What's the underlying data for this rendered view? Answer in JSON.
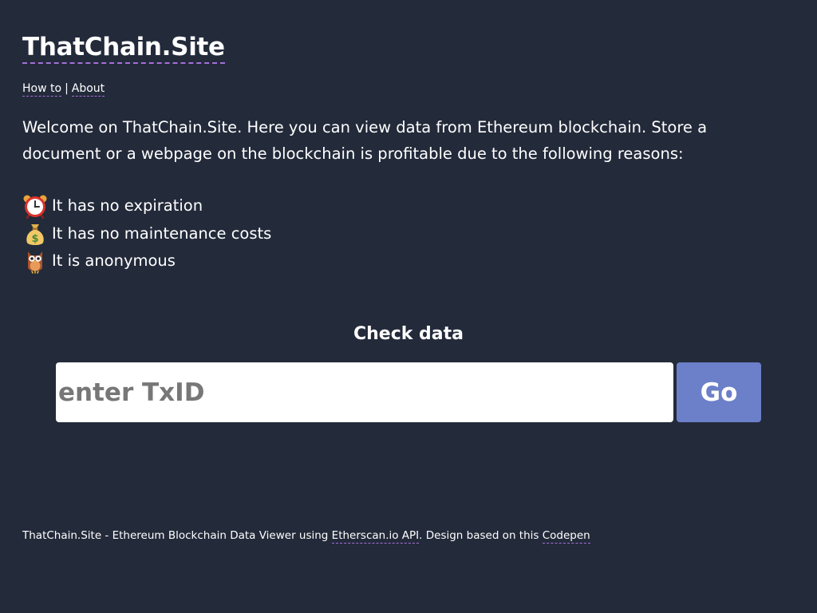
{
  "header": {
    "title": "ThatChain.Site"
  },
  "nav": {
    "how_to": "How to",
    "separator": "|",
    "about": "About"
  },
  "intro": {
    "text": "Welcome on ThatChain.Site. Here you can view data from Ethereum blockchain. Store a document or a webpage on the blockchain is profitable due to the following reasons:"
  },
  "features": [
    {
      "icon": "alarm-clock-icon",
      "label": "It has no expiration"
    },
    {
      "icon": "money-bag-icon",
      "label": "It has no maintenance costs"
    },
    {
      "icon": "owl-icon",
      "label": "It is anonymous"
    }
  ],
  "check": {
    "title": "Check data",
    "input_placeholder": "enter TxID",
    "input_value": "",
    "go_label": "Go"
  },
  "footer": {
    "prefix": "ThatChain.Site - Ethereum Blockchain Data Viewer using ",
    "etherscan_link": "Etherscan.io API",
    "middle": ". Design based on this ",
    "codepen_link": "Codepen"
  },
  "colors": {
    "background": "#232a3a",
    "accent_underline": "#a46fd8",
    "go_button": "#6b80c9"
  }
}
